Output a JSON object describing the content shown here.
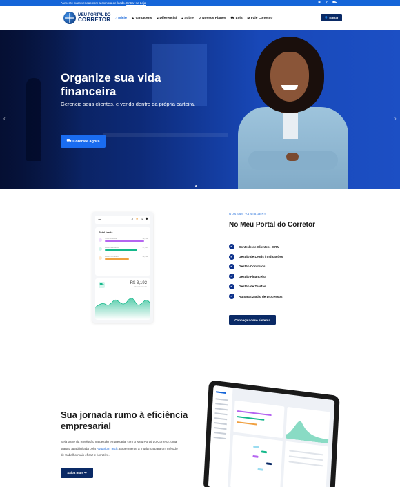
{
  "topbar": {
    "message": "Aumente suas vendas com a compra de leads.",
    "link": "Entrar na Loja",
    "icons": [
      "instagram-icon",
      "whatsapp-icon",
      "cart-icon"
    ]
  },
  "header": {
    "logo_line1": "MEU PORTAL DO",
    "logo_line2": "CORRETOR",
    "nav": [
      {
        "label": "Início",
        "icon": "home-icon",
        "active": true
      },
      {
        "label": "Vantagens",
        "icon": "star-icon"
      },
      {
        "label": "Diferencial",
        "icon": "heart-icon"
      },
      {
        "label": "Sobre",
        "icon": "info-icon"
      },
      {
        "label": "Nossos Planos",
        "icon": "rocket-icon"
      },
      {
        "label": "Loja",
        "icon": "cart-icon"
      },
      {
        "label": "Fale Conosco",
        "icon": "mail-icon"
      }
    ],
    "login_label": "Entrar"
  },
  "hero": {
    "title": "Organize sua vida financeira",
    "subtitle": "Gerencie seus clientes, e venda dentro da própria carteira.",
    "cta": "Contrate agora",
    "colors": {
      "cta": "#1a6cf0",
      "bg": "#0d2a78"
    }
  },
  "mock": {
    "card_label": "Total leads",
    "rows": [
      {
        "label": "Total de leads",
        "value": "12,362",
        "color": "#b565f0",
        "fill": 0.9
      },
      {
        "label": "Leads atendidos",
        "value": "$7,235",
        "color": "#14b88a",
        "fill": 0.75
      },
      {
        "label": "Leads vendidos",
        "value": "$2,992",
        "color": "#f0a040",
        "fill": 0.55
      }
    ],
    "value": "R$ 3,192",
    "value_sub": "Total de Vendas"
  },
  "advantages": {
    "kicker": "NOSSAS VANTAGENS",
    "title": "No Meu Portal do Corretor",
    "features": [
      "Controle de Clientes - CRM",
      "Gestão de Leads / Indicações",
      "Gestão Contratos",
      "Gestão Financeira",
      "Gestão de Tarefas",
      "Automatização de processos"
    ],
    "button": "Conheça nosso sistema"
  },
  "journey": {
    "title": "Sua jornada rumo à eficiência empresarial",
    "text_before": "Seja parte da revolução na gestão empresarial com o Meu Portal do Corretor, uma startup apadrinhada pela ",
    "text_link": "Aquarium Tech",
    "text_after": ". Experimente a mudança para um método de trabalho mais eficaz e lucrativo.",
    "button": "Saiba mais ➔"
  }
}
